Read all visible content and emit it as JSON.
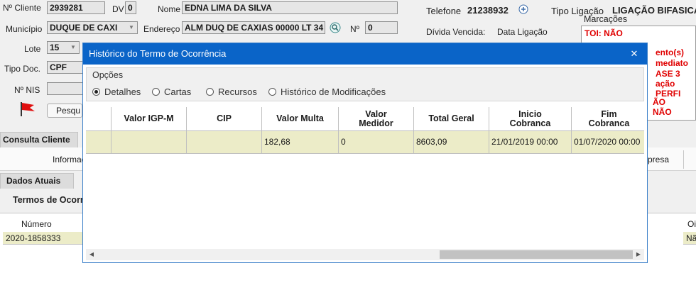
{
  "form": {
    "cliente_label": "Nº Cliente",
    "cliente_value": "2939281",
    "dv_label": "DV",
    "dv_value": "0",
    "nome_label": "Nome",
    "nome_value": "EDNA LIMA DA SILVA",
    "municipio_label": "Município",
    "municipio_value": "DUQUE  DE CAXI",
    "endereco_label": "Endereço",
    "endereco_value": "ALM DUQ DE CAXIAS 00000 LT 34",
    "numero_label": "Nº",
    "numero_value": "0",
    "lote_label": "Lote",
    "lote_value": "15",
    "tipo_doc_label": "Tipo Doc.",
    "tipo_doc_value": "CPF",
    "nis_label": "Nº NIS",
    "pesquisar_label": "Pesqu",
    "telefone_label": "Telefone",
    "telefone_value": "21238932",
    "tipo_ligacao_label": "Tipo Ligação",
    "tipo_ligacao_value": "LIGAÇÃO BIFASICA",
    "divida_label": "Dívida Vencida:",
    "data_ligacao_label": "Data Ligação",
    "marcacoes_title": "Marcações",
    "marcacoes": [
      "TOI: NÃO",
      "ento(s)",
      "mediato",
      "ASE 3",
      "ação PERFI",
      "ÃO",
      "NÃO"
    ]
  },
  "tabs": {
    "consulta_cliente": "Consulta Cliente",
    "informacoes": "Informac",
    "empresa": "presa",
    "dados_atuais": "Dados Atuais",
    "termos": "Termos de Ocorrê"
  },
  "bg_table": {
    "col_numero": "Número",
    "col_right": "Oi",
    "row_numero": "2020-1858333",
    "row_right": "Nã"
  },
  "dialog": {
    "title": "Histórico do Termo de Ocorrência",
    "close": "✕",
    "options_label": "Opções",
    "options": [
      "Detalhes",
      "Cartas",
      "Recursos",
      "Histórico de Modificações"
    ],
    "selected_option": "Detalhes",
    "columns": [
      "",
      "Valor IGP-M",
      "CIP",
      "Valor Multa",
      "Valor Medidor",
      "Total Geral",
      "Inicio Cobranca",
      "Fim Cobranca"
    ],
    "rows": [
      [
        "",
        "",
        "",
        "182,68",
        "0",
        "8603,09",
        "21/01/2019 00:00",
        "01/07/2020 00:00"
      ]
    ]
  },
  "colors": {
    "titlebar": "#0a64c8",
    "row_highlight": "#ececc8",
    "alert_red": "#e00000"
  },
  "icons": [
    "plus-icon",
    "search-icon",
    "red-flag-icon",
    "chevron-down-icon",
    "close-icon",
    "scroll-left-icon",
    "scroll-right-icon"
  ]
}
